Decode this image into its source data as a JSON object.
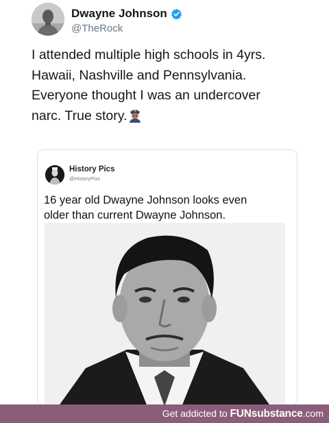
{
  "author": {
    "display_name": "Dwayne Johnson",
    "handle": "@TheRock",
    "verified_icon": "verified-badge-icon",
    "verified_color": "#1da1f2"
  },
  "tweet": {
    "text": "I attended multiple high schools in 4yrs.\nHawaii, Nashville and Pennsylvania.\nEveryone thought I was an undercover\nnarc. True story.",
    "emoji": "police-officer-emoji"
  },
  "quoted_tweet": {
    "display_name": "History Pics",
    "handle": "@HistoryPixs",
    "text": "16 year old Dwayne Johnson looks even\nolder than current Dwayne Johnson.",
    "photo": "black-and-white-portrait-photo"
  },
  "footer": {
    "prefix": "Get addicted to ",
    "brand": "FUNsubstance",
    "suffix": ".com",
    "bar_color": "#8a5d78"
  }
}
